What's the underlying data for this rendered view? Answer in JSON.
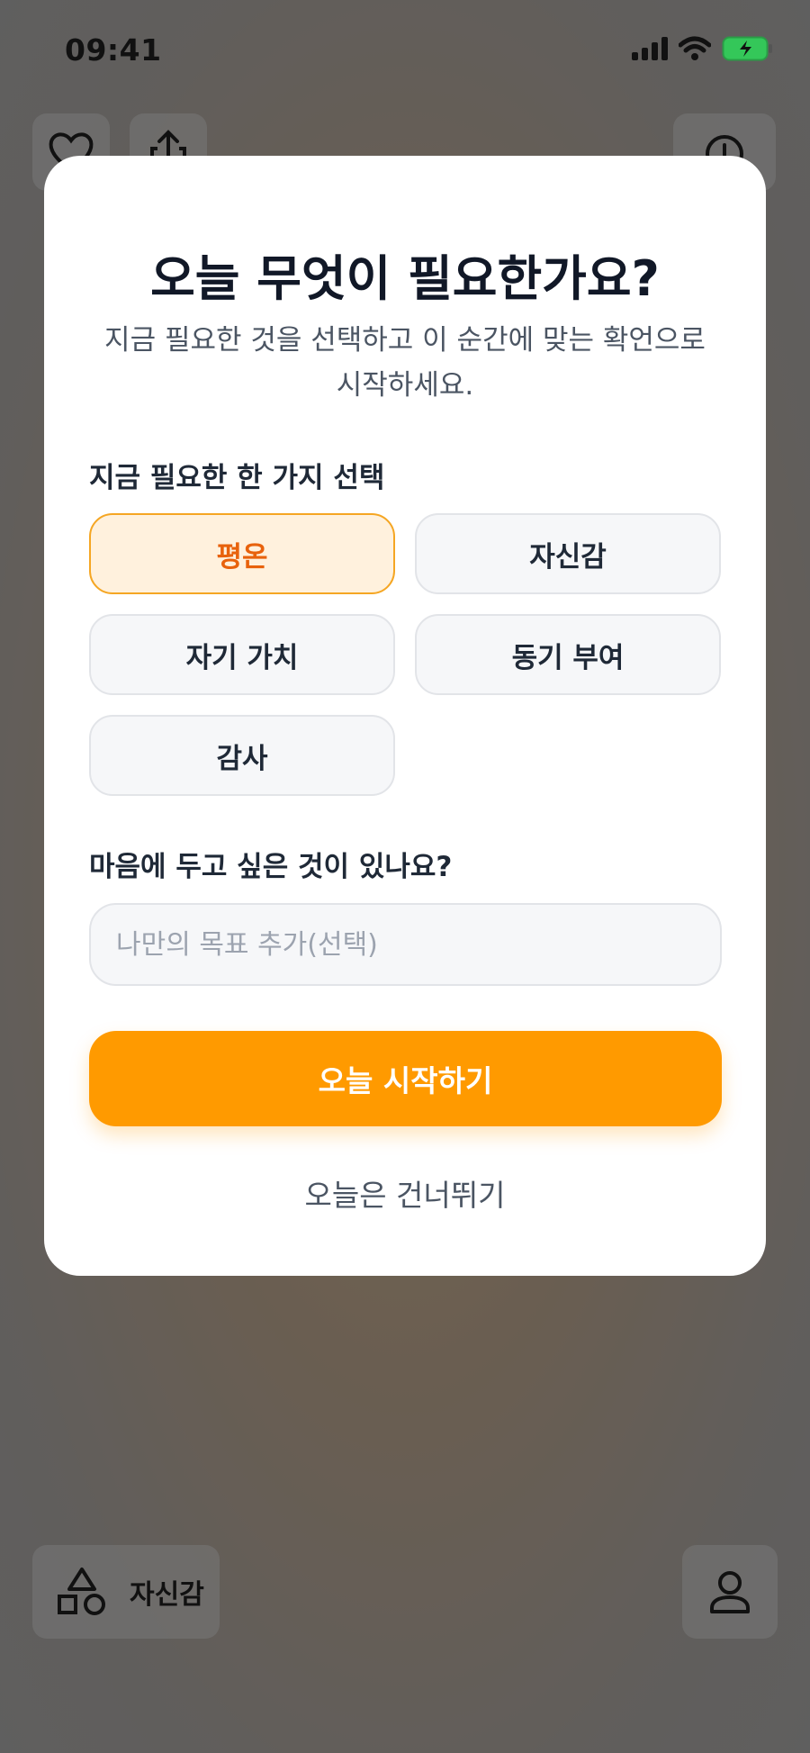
{
  "status_bar": {
    "time": "09:41"
  },
  "background": {
    "bottom_left_label": "자신감",
    "icons": [
      "heart-icon",
      "share-icon",
      "timer-icon",
      "shapes-icon",
      "profile-icon"
    ]
  },
  "modal": {
    "title": "오늘 무엇이 필요한가요?",
    "subtitle": "지금 필요한 것을 선택하고 이 순간에 맞는 확언으로 시작하세요.",
    "choice_label": "지금 필요한 한 가지 선택",
    "options": [
      {
        "label": "평온",
        "selected": true
      },
      {
        "label": "자신감",
        "selected": false
      },
      {
        "label": "자기 가치",
        "selected": false
      },
      {
        "label": "동기 부여",
        "selected": false
      },
      {
        "label": "감사",
        "selected": false
      }
    ],
    "goal_label": "마음에 두고 싶은 것이 있나요?",
    "goal_input": {
      "value": "",
      "placeholder": "나만의 목표 추가(선택)"
    },
    "start_button": "오늘 시작하기",
    "skip_link": "오늘은 건너뛰기"
  },
  "colors": {
    "accent": "#ff9a00",
    "selected_bg": "#fff1dd",
    "selected_text": "#e8620c",
    "battery": "#34c759"
  }
}
